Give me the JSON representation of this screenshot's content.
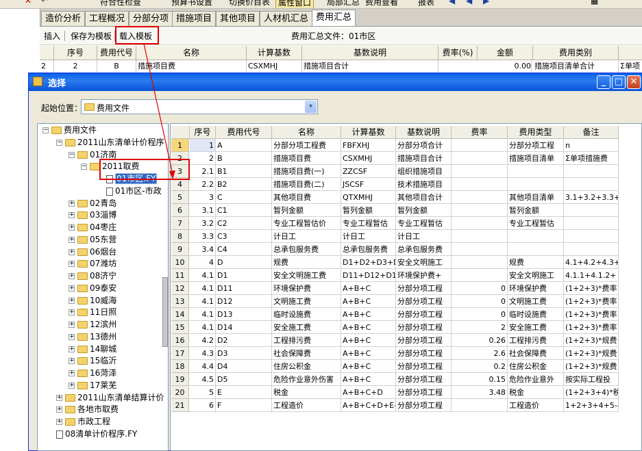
{
  "toolbar": {
    "items": [
      "符合性检查",
      "预算书设置",
      "切换价目表",
      "属性窗口",
      "局部汇总",
      "费用查看",
      "报表"
    ]
  },
  "tabs": [
    "造价分析",
    "工程概况",
    "分部分项",
    "措施项目",
    "其他项目",
    "人材机汇总",
    "费用汇总"
  ],
  "subbar": {
    "insert": "插入",
    "save_template": "保存为模板",
    "load_template": "载入模板",
    "file_label": "费用汇总文件：01市区"
  },
  "bg_grid": {
    "headers": [
      "序号",
      "费用代号",
      "名称",
      "计算基数",
      "基数说明",
      "费率(%)",
      "金额",
      "费用类别"
    ],
    "row": [
      "2",
      "2",
      "B",
      "措施项目费",
      "CSXMHJ",
      "措施项目合计",
      "",
      "0.00",
      "措施项目清单合计",
      "Σ单项"
    ]
  },
  "dialog": {
    "title": "选择",
    "start_label": "起始位置：",
    "start_value": "费用文件",
    "min_btn": "_",
    "max_btn": "□",
    "close_btn": "✕",
    "dropdown_arrow": "▾"
  },
  "tree": [
    {
      "label": "费用文件",
      "pm": "−"
    },
    {
      "label": "2011山东清单计价程序",
      "pm": "−"
    },
    {
      "label": "01济南",
      "pm": "−"
    },
    {
      "label": "2011取费",
      "pm": "−"
    },
    {
      "label": "01市区.FY",
      "pm": ""
    },
    {
      "label": "01市区-市政",
      "pm": ""
    },
    {
      "label": "02青岛",
      "pm": "+"
    },
    {
      "label": "03淄博",
      "pm": "+"
    },
    {
      "label": "04枣庄",
      "pm": "+"
    },
    {
      "label": "05东营",
      "pm": "+"
    },
    {
      "label": "06烟台",
      "pm": "+"
    },
    {
      "label": "07潍坊",
      "pm": "+"
    },
    {
      "label": "08济宁",
      "pm": "+"
    },
    {
      "label": "09泰安",
      "pm": "+"
    },
    {
      "label": "10威海",
      "pm": "+"
    },
    {
      "label": "11日照",
      "pm": "+"
    },
    {
      "label": "12滨州",
      "pm": "+"
    },
    {
      "label": "13德州",
      "pm": "+"
    },
    {
      "label": "14聊城",
      "pm": "+"
    },
    {
      "label": "15临沂",
      "pm": "+"
    },
    {
      "label": "16菏泽",
      "pm": "+"
    },
    {
      "label": "17莱芜",
      "pm": "+"
    },
    {
      "label": "2011山东清单结算计价",
      "pm": "+"
    },
    {
      "label": "各地市取费",
      "pm": "+"
    },
    {
      "label": "市政工程",
      "pm": "+"
    },
    {
      "label": "08清单计价程序.FY",
      "pm": ""
    }
  ],
  "grid": {
    "headers": [
      "序号",
      "费用代号",
      "名称",
      "计算基数",
      "基数说明",
      "费率",
      "费用类型",
      "备注"
    ],
    "rows": [
      [
        "1",
        "1",
        "A",
        "分部分项工程费",
        "FBFXHJ",
        "分部分项合计",
        "",
        "分部分项工程",
        "n"
      ],
      [
        "2",
        "2",
        "B",
        "措施项目费",
        "CSXMHJ",
        "措施项目合计",
        "",
        "措施项目清单",
        "Σ单项措施费"
      ],
      [
        "3",
        "2.1",
        "B1",
        "措施项目费(一)",
        "ZZCSF",
        "组织措施项目",
        "",
        "",
        ""
      ],
      [
        "4",
        "2.2",
        "B2",
        "措施项目费(二)",
        "JSCSF",
        "技术措施项目",
        "",
        "",
        ""
      ],
      [
        "5",
        "3",
        "C",
        "其他项目费",
        "QTXMHJ",
        "其他项目合计",
        "",
        "其他项目清单",
        "3.1+3.2+3.3+"
      ],
      [
        "6",
        "3.1",
        "C1",
        "暂列金额",
        "暂列金额",
        "暂列金额",
        "",
        "暂列金额",
        ""
      ],
      [
        "7",
        "3.2",
        "C2",
        "专业工程暂估价",
        "专业工程暂估",
        "专业工程暂估",
        "",
        "专业工程暂估",
        ""
      ],
      [
        "8",
        "3.3",
        "C3",
        "计日工",
        "计日工",
        "计日工",
        "",
        "",
        ""
      ],
      [
        "9",
        "3.4",
        "C4",
        "总承包服务费",
        "总承包服务费",
        "总承包服务费",
        "",
        "",
        ""
      ],
      [
        "10",
        "4",
        "D",
        "规费",
        "D1+D2+D3+D4+",
        "安全文明施工",
        "",
        "规费",
        "4.1+4.2+4.3+"
      ],
      [
        "11",
        "4.1",
        "D1",
        "安全文明施工费",
        "D11+D12+D13+",
        "环境保护费+",
        "",
        "安全文明施工",
        "4.1.1+4.1.2+"
      ],
      [
        "12",
        "4.1",
        "D11",
        "环境保护费",
        "A+B+C",
        "分部分项工程",
        "0",
        "环境保护费",
        "(1+2+3)*费率"
      ],
      [
        "13",
        "4.1",
        "D12",
        "文明施工费",
        "A+B+C",
        "分部分项工程",
        "0",
        "文明施工费",
        "(1+2+3)*费率"
      ],
      [
        "14",
        "4.1",
        "D13",
        "临时设施费",
        "A+B+C",
        "分部分项工程",
        "0",
        "临时设施费",
        "(1+2+3)*费率"
      ],
      [
        "15",
        "4.1",
        "D14",
        "安全施工费",
        "A+B+C",
        "分部分项工程",
        "2",
        "安全施工费",
        "(1+2+3)*费率"
      ],
      [
        "16",
        "4.2",
        "D2",
        "工程排污费",
        "A+B+C",
        "分部分项工程",
        "0.26",
        "工程排污费",
        "(1+2+3)*规费"
      ],
      [
        "17",
        "4.3",
        "D3",
        "社会保障费",
        "A+B+C",
        "分部分项工程",
        "2.6",
        "社会保障费",
        "(1+2+3)*规费"
      ],
      [
        "18",
        "4.4",
        "D4",
        "住房公积金",
        "A+B+C",
        "分部分项工程",
        "0.2",
        "住房公积金",
        "(1+2+3)*规费"
      ],
      [
        "19",
        "4.5",
        "D5",
        "危险作业意外伤害",
        "A+B+C",
        "分部分项工程",
        "0.15",
        "危险作业意外",
        "按实际工程投"
      ],
      [
        "20",
        "5",
        "E",
        "税金",
        "A+B+C+D",
        "分部分项工程",
        "3.48",
        "税金",
        "(1+2+3+4)*税"
      ],
      [
        "21",
        "6",
        "F",
        "工程造价",
        "A+B+C+D+E-D3",
        "分部分项工程",
        "",
        "工程造价",
        "1+2+3+4+5-4."
      ]
    ]
  },
  "colors": {
    "title_blue": "#0a5fe8",
    "highlight_red": "#e00000",
    "selected_row": "#f6d77c",
    "tree_select": "#316ac5"
  }
}
